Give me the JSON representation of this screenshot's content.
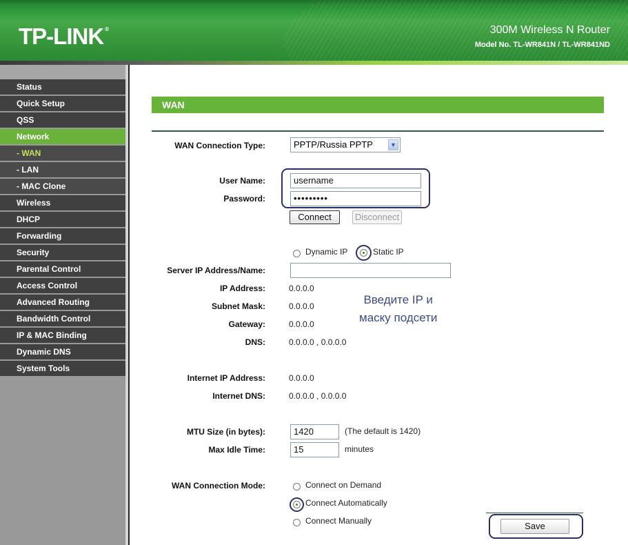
{
  "header": {
    "logo": "TP-LINK",
    "logo_mark": "®",
    "product_title": "300M Wireless N Router",
    "model": "Model No. TL-WR841N / TL-WR841ND"
  },
  "sidebar": {
    "items": [
      {
        "label": "Status"
      },
      {
        "label": "Quick Setup"
      },
      {
        "label": "QSS"
      },
      {
        "label": "Network",
        "active": true
      },
      {
        "label": "- WAN",
        "sub": true,
        "current": true
      },
      {
        "label": "- LAN",
        "sub": true
      },
      {
        "label": "- MAC Clone",
        "sub": true
      },
      {
        "label": "Wireless"
      },
      {
        "label": "DHCP"
      },
      {
        "label": "Forwarding"
      },
      {
        "label": "Security"
      },
      {
        "label": "Parental Control"
      },
      {
        "label": "Access Control"
      },
      {
        "label": "Advanced Routing"
      },
      {
        "label": "Bandwidth Control"
      },
      {
        "label": "IP & MAC Binding"
      },
      {
        "label": "Dynamic DNS"
      },
      {
        "label": "System Tools"
      }
    ]
  },
  "main": {
    "title": "WAN",
    "connection_type": {
      "label": "WAN Connection Type:",
      "value": "PPTP/Russia PPTP"
    },
    "username": {
      "label": "User Name:",
      "value": "username"
    },
    "password": {
      "label": "Password:",
      "value": "•••••••••"
    },
    "connect_button": "Connect",
    "disconnect_button": "Disconnect",
    "ip_mode": {
      "dynamic": "Dynamic IP",
      "static": "Static IP",
      "selected": "Static IP"
    },
    "server": {
      "label": "Server IP Address/Name:",
      "value": ""
    },
    "ip_address": {
      "label": "IP Address:",
      "value": "0.0.0.0"
    },
    "subnet_mask": {
      "label": "Subnet Mask:",
      "value": "0.0.0.0"
    },
    "gateway": {
      "label": "Gateway:",
      "value": "0.0.0.0"
    },
    "dns": {
      "label": "DNS:",
      "value": "0.0.0.0 , 0.0.0.0"
    },
    "internet_ip": {
      "label": "Internet IP Address:",
      "value": "0.0.0.0"
    },
    "internet_dns": {
      "label": "Internet DNS:",
      "value": "0.0.0.0 , 0.0.0.0"
    },
    "mtu": {
      "label": "MTU Size (in bytes):",
      "value": "1420",
      "hint": "(The default is 1420)"
    },
    "idle": {
      "label": "Max Idle Time:",
      "value": "15",
      "unit": "minutes"
    },
    "mode": {
      "label": "WAN Connection Mode:",
      "options": [
        "Connect on Demand",
        "Connect Automatically",
        "Connect Manually"
      ],
      "selected": "Connect Automatically"
    },
    "save_button": "Save",
    "annotation_line1": "Введите IP и",
    "annotation_line2": "маску подсети"
  }
}
